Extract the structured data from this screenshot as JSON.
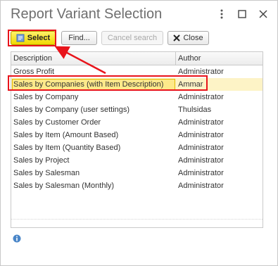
{
  "window": {
    "title": "Report Variant Selection"
  },
  "toolbar": {
    "select_label": "Select",
    "find_label": "Find...",
    "cancel_search_label": "Cancel search",
    "close_label": "Close"
  },
  "grid": {
    "columns": [
      "Description",
      "Author"
    ],
    "rows": [
      {
        "description": "Gross Profit",
        "author": "Administrator",
        "selected": false
      },
      {
        "description": "Sales by Companies (with Item Description)",
        "author": "Ammar",
        "selected": true
      },
      {
        "description": "Sales by Company",
        "author": "Administrator",
        "selected": false
      },
      {
        "description": "Sales by Company (user settings)",
        "author": "Thulsidas",
        "selected": false
      },
      {
        "description": "Sales by Customer Order",
        "author": "Administrator",
        "selected": false
      },
      {
        "description": "Sales by Item (Amount Based)",
        "author": "Administrator",
        "selected": false
      },
      {
        "description": "Sales by Item (Quantity Based)",
        "author": "Administrator",
        "selected": false
      },
      {
        "description": "Sales by Project",
        "author": "Administrator",
        "selected": false
      },
      {
        "description": "Sales by Salesman",
        "author": "Administrator",
        "selected": false
      },
      {
        "description": "Sales by Salesman (Monthly)",
        "author": "Administrator",
        "selected": false
      }
    ]
  },
  "colors": {
    "annotation_red": "#e8141b",
    "select_button_yellow": "#f0d800",
    "selected_row": "#fde98a"
  }
}
